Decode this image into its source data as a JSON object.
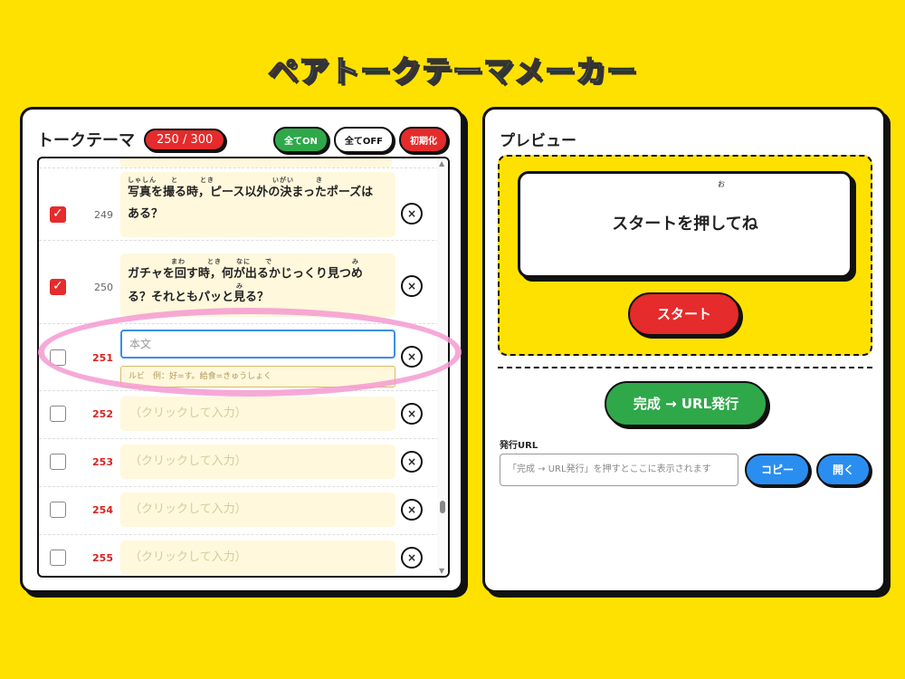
{
  "app": {
    "title_parts": [
      {
        "text": "ペ",
        "color": "#e52b2b"
      },
      {
        "text": "ア",
        "color": "#2a8ef0"
      },
      {
        "text": "ト",
        "color": "#ffffff"
      },
      {
        "text": "ー",
        "color": "#2fa84a"
      },
      {
        "text": "ク",
        "color": "#e52b2b"
      },
      {
        "text": "テ",
        "color": "#2a8ef0"
      },
      {
        "text": "ー",
        "color": "#ffffff"
      },
      {
        "text": "マ",
        "color": "#2fa84a"
      },
      {
        "text": "メ",
        "color": "#e52b2b"
      },
      {
        "text": "ー",
        "color": "#2a8ef0"
      },
      {
        "text": "カ",
        "color": "#ffffff"
      },
      {
        "text": "ー",
        "color": "#2fa84a"
      }
    ]
  },
  "left": {
    "title": "トークテーマ",
    "count": "250 / 300",
    "all_on": "全てON",
    "all_off": "全てOFF",
    "reset": "初期化"
  },
  "rows": [
    {
      "num": "249",
      "checked": true,
      "lines": [
        {
          "ruby": "しゃしん　　と　　　とき　　　　　　　　いがい　　　き",
          "text": "写真を撮る時，ピース以外の決まったポーズは"
        },
        {
          "ruby": "",
          "text": "ある？"
        }
      ]
    },
    {
      "num": "250",
      "checked": true,
      "lines": [
        {
          "ruby": "　　　　　　まわ　　　とき　　なに　　で　　　　　　　　　　　み",
          "text": "ガチャを回す時，何が出るかじっくり見つめ"
        },
        {
          "ruby": "　　　　　　　　　　　　　　　み",
          "text": "る？それともパッと見る？"
        }
      ]
    }
  ],
  "editing": {
    "num": "251",
    "body_placeholder": "本文",
    "ruby_placeholder": "ルビ　例：好=す。給食=きゅうしょく"
  },
  "empty_rows": [
    {
      "num": "252",
      "placeholder": "（クリックして入力）"
    },
    {
      "num": "253",
      "placeholder": "（クリックして入力）"
    },
    {
      "num": "254",
      "placeholder": "（クリックして入力）"
    },
    {
      "num": "255",
      "placeholder": "（クリックして入力）"
    }
  ],
  "delete_glyph": "×",
  "scroll": {
    "up": "▲",
    "down": "▼"
  },
  "right": {
    "title": "プレビュー",
    "preview_ruby": "お",
    "preview_text": "スタートを押してね",
    "start": "スタート",
    "publish": "完成 → URL発行",
    "url_label": "発行URL",
    "url_placeholder": "「完成 → URL発行」を押すとここに表示されます",
    "copy": "コピー",
    "open": "開く"
  }
}
